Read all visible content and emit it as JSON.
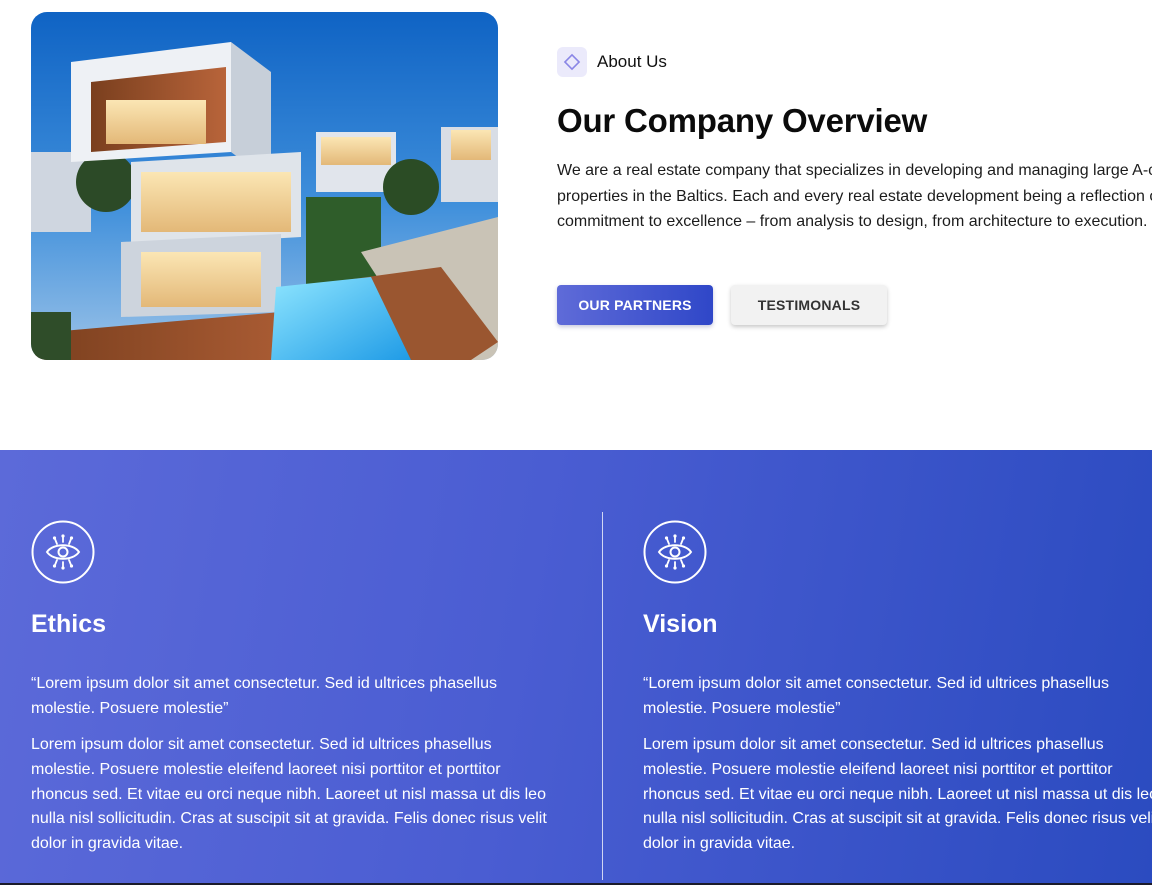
{
  "about": {
    "badge_label": "About Us",
    "title": "Our Company Overview",
    "description": "We are a real estate company that specializes in developing and managing large A-class properties in the Baltics. Each and every real estate development being a reflection of our commitment to excellence – from analysis to design, from architecture to execution.",
    "buttons": {
      "partners": "OUR PARTNERS",
      "testimonials": "TESTIMONALS"
    },
    "image_alt": "modern-villa-with-pool"
  },
  "values": {
    "items": [
      {
        "icon": "eye-icon",
        "title": "Ethics",
        "quote": "“Lorem ipsum dolor sit amet consectetur. Sed id ultrices phasellus molestie. Posuere molestie”",
        "body": "Lorem ipsum dolor sit amet consectetur. Sed id ultrices phasellus molestie. Posuere molestie eleifend laoreet nisi porttitor et porttitor rhoncus sed. Et vitae eu orci neque nibh. Laoreet ut nisl massa ut dis leo nulla nisl sollicitudin. Cras at suscipit sit at gravida. Felis donec risus velit dolor in gravida vitae."
      },
      {
        "icon": "eye-icon",
        "title": "Vision",
        "quote": "“Lorem ipsum dolor sit amet consectetur. Sed id ultrices phasellus molestie. Posuere molestie”",
        "body": "Lorem ipsum dolor sit amet consectetur. Sed id ultrices phasellus molestie. Posuere molestie eleifend laoreet nisi porttitor et porttitor rhoncus sed. Et vitae eu orci neque nibh. Laoreet ut nisl massa ut dis leo nulla nisl sollicitudin. Cras at suscipit sit at gravida. Felis donec risus velit dolor in gravida vitae."
      }
    ]
  },
  "colors": {
    "accent": "#3f55cc",
    "gradient_start": "#5c6ad9",
    "gradient_end": "#2b4bc0",
    "badge_bg": "#ebeafb"
  }
}
